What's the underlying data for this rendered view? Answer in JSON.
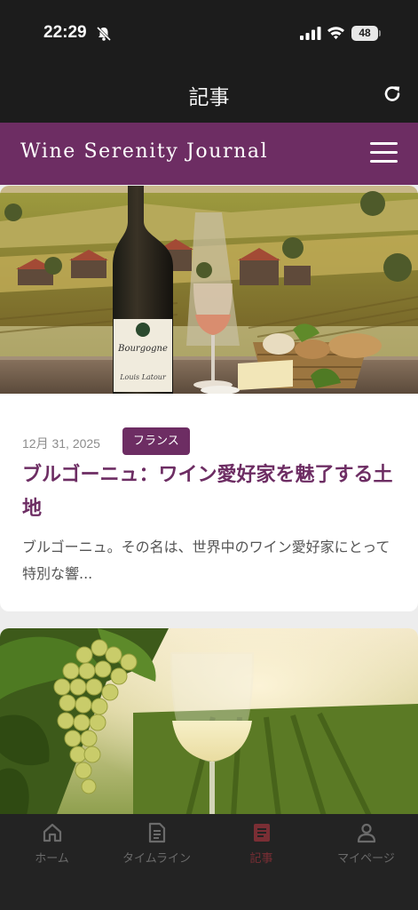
{
  "status_bar": {
    "time": "22:29",
    "battery": "48"
  },
  "header": {
    "title": "記事"
  },
  "banner": {
    "site_name": "Wine Serenity Journal"
  },
  "articles": [
    {
      "date": "12月 31, 2025",
      "tag": "フランス",
      "title": "ブルゴーニュ：ワイン愛好家を魅了する土地",
      "excerpt": "ブルゴーニュ。その名は、世界中のワイン愛好家にとって特別な響...",
      "bottle_label_1": "Bourgogne",
      "bottle_label_2": "Louis Latour"
    },
    {
      "date": "",
      "tag": "",
      "title": "",
      "excerpt": ""
    }
  ],
  "tab_bar": {
    "items": [
      {
        "label": "ホーム",
        "icon": "home-icon"
      },
      {
        "label": "タイムライン",
        "icon": "timeline-icon"
      },
      {
        "label": "記事",
        "icon": "article-icon"
      },
      {
        "label": "マイページ",
        "icon": "user-icon"
      }
    ],
    "active_index": 2
  },
  "colors": {
    "brand": "#6d2d63",
    "active_tab": "#7a2e34",
    "background": "#1c1c1c"
  }
}
